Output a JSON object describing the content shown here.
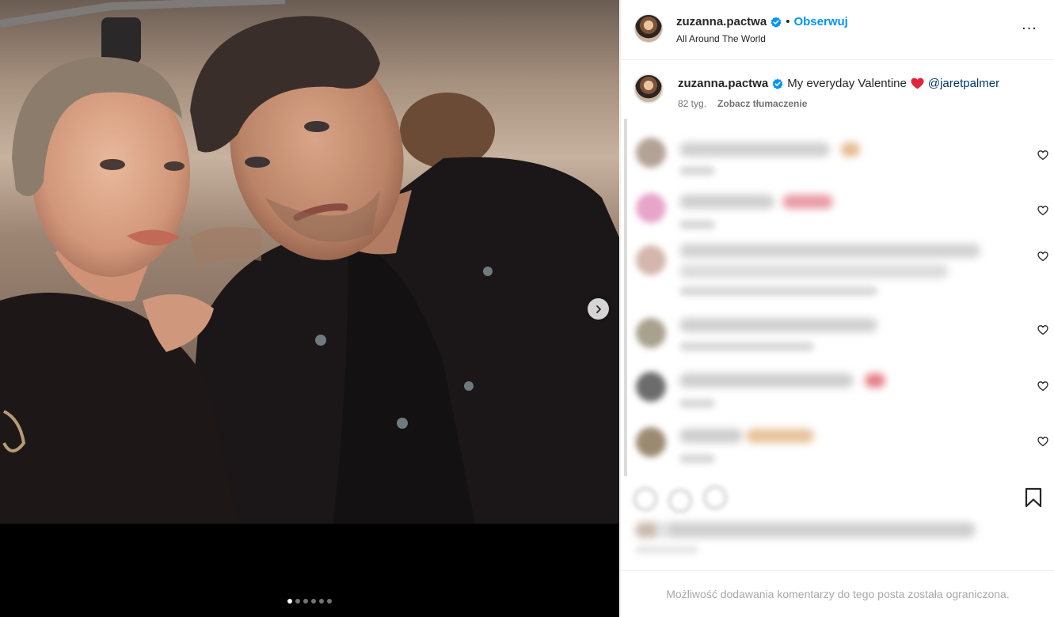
{
  "media": {
    "carousel": {
      "total_slides": 6,
      "active_index": 0
    },
    "next_icon": "chevron-right-icon"
  },
  "header": {
    "username": "zuzanna.pactwa",
    "verified": true,
    "separator": "•",
    "follow_label": "Obserwuj",
    "location": "All Around The World",
    "more_icon": "more-horizontal-icon",
    "more_label": "..."
  },
  "caption": {
    "username": "zuzanna.pactwa",
    "text": "My everyday Valentine",
    "emoji": "red-heart",
    "mention": "@jaretpalmer",
    "age": "82 tyg.",
    "translate_label": "Zobacz tłumaczenie"
  },
  "comments": {
    "blurred": true,
    "like_icon": "heart-outline-icon"
  },
  "actions": {
    "save_icon": "bookmark-icon"
  },
  "footer": {
    "notice": "Możliwość dodawania komentarzy do tego posta została ograniczona."
  },
  "colors": {
    "accent_link": "#0095f6",
    "mention": "#00376b",
    "verified_badge": "#0095f6",
    "muted_text": "#737373",
    "footer_text": "#a8a8a8"
  }
}
